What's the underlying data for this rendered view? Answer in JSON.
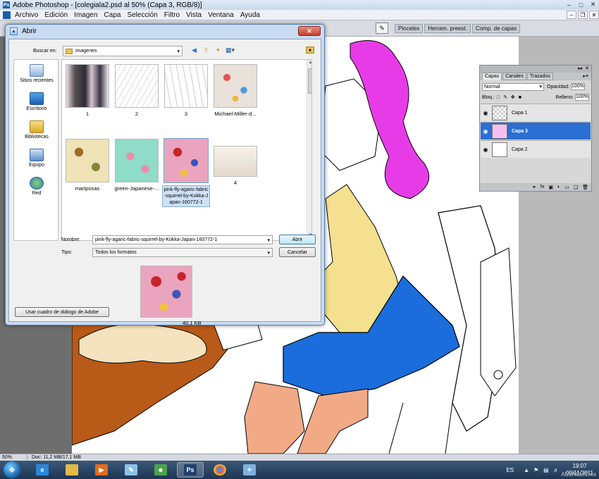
{
  "app": {
    "title": "Adobe Photoshop - [colegiala2.psd al 50% (Capa 3, RGB/8)]",
    "menu": [
      "Archivo",
      "Edición",
      "Imagen",
      "Capa",
      "Selección",
      "Filtro",
      "Vista",
      "Ventana",
      "Ayuda"
    ]
  },
  "panel_tabs": [
    "Pinceles",
    "Herram. preest.",
    "Comp. de capas"
  ],
  "layers_panel": {
    "tabs": [
      "Capas",
      "Canales",
      "Trazados"
    ],
    "blend_mode": "Normal",
    "opacity_label": "Opacidad:",
    "opacity_value": "100%",
    "lock_label": "Bloq.:",
    "fill_label": "Relleno:",
    "fill_value": "100%",
    "layers": [
      {
        "name": "Capa 1",
        "selected": false
      },
      {
        "name": "Capa 3",
        "selected": true
      },
      {
        "name": "Capa 2",
        "selected": false
      }
    ]
  },
  "status": {
    "zoom": "50%",
    "doc_info": "Doc: 11,2 MB/17,1 MB"
  },
  "dialog": {
    "title": "Abrir",
    "lookin_label": "Buscar en:",
    "lookin_value": "imagenes",
    "places": [
      "Sitios recientes",
      "Escritorio",
      "Bibliotecas",
      "Equipo",
      "Red"
    ],
    "files": [
      {
        "name": "1"
      },
      {
        "name": "2"
      },
      {
        "name": "3"
      },
      {
        "name": "Michael-Miller-d..."
      },
      {
        "name": "mariposas"
      },
      {
        "name": "green-Japanese-..."
      },
      {
        "name": "pink-fly-agaric-fabric-squirrel-by-Kokka-Japan-160772-1"
      },
      {
        "name": "4"
      }
    ],
    "filename_label": "Nombre:",
    "filename_value": "pink-fly-agaric-fabric-squirrel-by-Kokka-Japan-160772-1",
    "filetype_label": "Tipo:",
    "filetype_value": "Todos los formatos",
    "open_button": "Abrir",
    "cancel_button": "Cancelar",
    "adobe_dialog_button": "Usar cuadro de diálogo de Adobe",
    "preview_size": "40,1 KB"
  },
  "taskbar": {
    "lang": "ES",
    "time": "19:07",
    "date": "09/11/2011"
  },
  "watermark": "AULACLIC.es",
  "colors": {
    "hair": "#e83be8",
    "skirt": "#1a6ddb",
    "shirt": "#f5e08f",
    "skin": "#f2aa86",
    "table": "#b85a18",
    "accent": "#2a6fd1"
  }
}
